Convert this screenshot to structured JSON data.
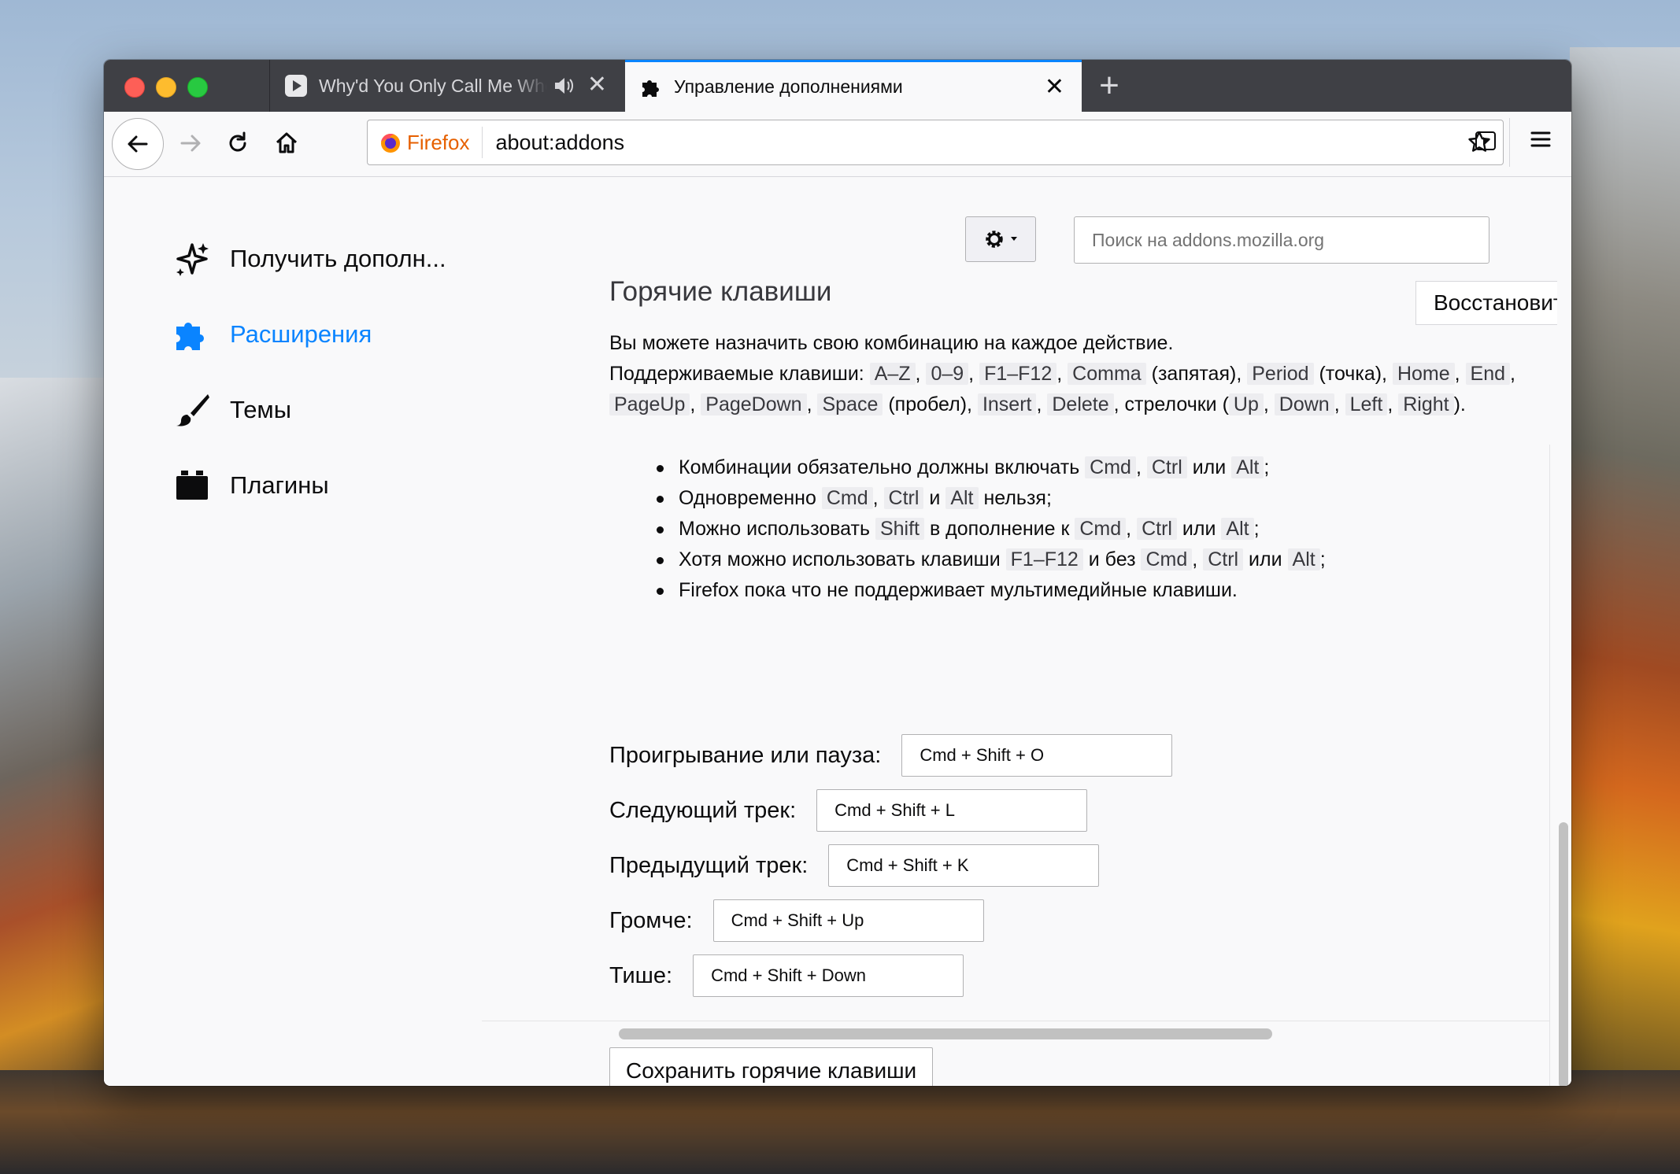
{
  "tabs": [
    {
      "title": "Why'd You Only Call Me When You're High?",
      "favicon": "play-icon",
      "has_sound": true
    },
    {
      "title": "Управление дополнениями",
      "favicon": "puzzle-icon",
      "active": true
    }
  ],
  "navbar": {
    "identity_label": "Firefox",
    "url": "about:addons"
  },
  "sidebar": {
    "items": [
      {
        "label": "Получить дополн...",
        "icon": "sparkle-icon"
      },
      {
        "label": "Расширения",
        "icon": "puzzle-icon",
        "active": true
      },
      {
        "label": "Темы",
        "icon": "brush-icon"
      },
      {
        "label": "Плагины",
        "icon": "plugin-icon"
      }
    ]
  },
  "header": {
    "search_placeholder": "Поиск на addons.mozilla.org"
  },
  "panel": {
    "title": "Горячие клавиши",
    "restore_label": "Восстановить",
    "intro": "Вы можете назначить свою комбинацию на каждое действие.",
    "supported_prefix": "Поддерживаемые клавиши:",
    "keys": [
      "A–Z",
      "0–9",
      "F1–F12",
      "Comma",
      "Period",
      "Home",
      "End",
      "PageUp",
      "PageDown",
      "Space",
      "Insert",
      "Delete",
      "Up",
      "Down",
      "Left",
      "Right"
    ],
    "comma_note": "(запятая)",
    "period_note": "(точка)",
    "space_note": "(пробел)",
    "arrows_word": "стрелочки",
    "rules": {
      "r1_text": "Комбинации обязательно должны включать",
      "r2_text": "Одновременно",
      "r2_tail": "нельзя;",
      "r3_text": "Можно использовать",
      "r3_mid": "в дополнение к",
      "r4_text": "Хотя можно использовать клавиши",
      "r4_mid": "и без",
      "r5_text": "Firefox пока что не поддерживает мультимедийные клавиши.",
      "cmd": "Cmd",
      "ctrl": "Ctrl",
      "alt": "Alt",
      "shift": "Shift",
      "f1f12": "F1–F12",
      "or": "или",
      "and": "и"
    },
    "shortcuts": [
      {
        "label": "Проигрывание или пауза:",
        "value": "Cmd + Shift + O"
      },
      {
        "label": "Следующий трек:",
        "value": "Cmd + Shift + L"
      },
      {
        "label": "Предыдущий трек:",
        "value": "Cmd + Shift + K"
      },
      {
        "label": "Громче:",
        "value": "Cmd + Shift + Up"
      },
      {
        "label": "Тише:",
        "value": "Cmd + Shift + Down"
      }
    ],
    "save_label": "Сохранить горячие клавиши"
  },
  "colors": {
    "accent": "#0a84ff",
    "titlebar": "#3f4045",
    "firefox_orange": "#e66000"
  }
}
